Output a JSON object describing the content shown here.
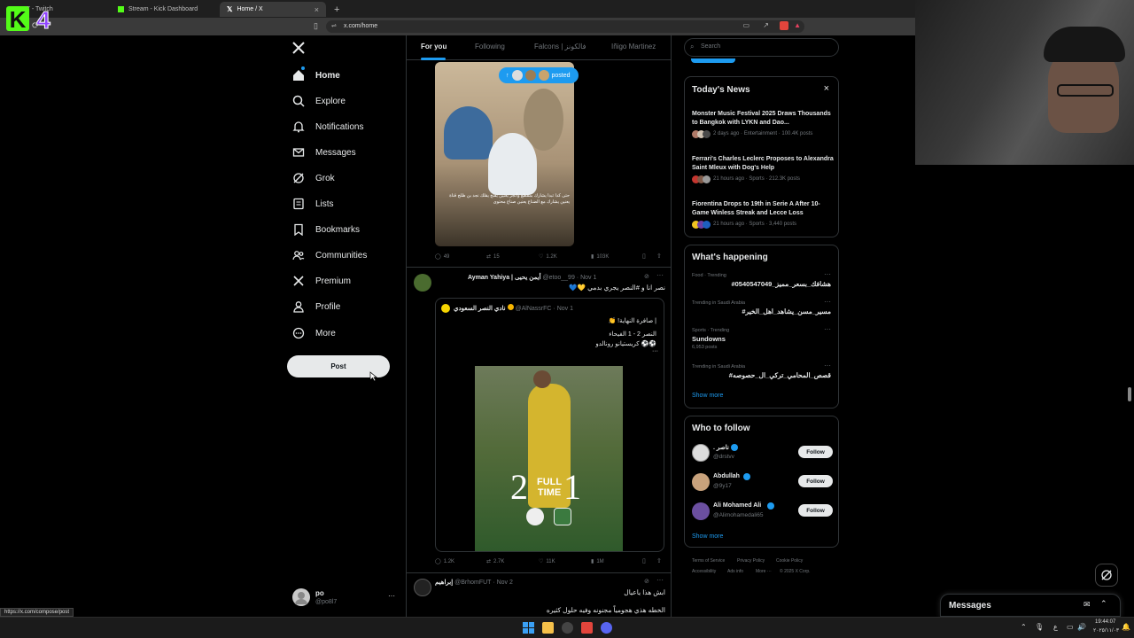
{
  "browser": {
    "tabs": [
      {
        "label": "7 - Twitch"
      },
      {
        "label": "Stream - Kick Dashboard"
      },
      {
        "label": "Home / X"
      }
    ],
    "url": "x.com/home",
    "status_url": "https://x.com/compose/post"
  },
  "overlay": {
    "kick_letter": "K",
    "kick_number": "4"
  },
  "nav": {
    "items": [
      {
        "label": "Home"
      },
      {
        "label": "Explore"
      },
      {
        "label": "Notifications"
      },
      {
        "label": "Messages"
      },
      {
        "label": "Grok"
      },
      {
        "label": "Lists"
      },
      {
        "label": "Bookmarks"
      },
      {
        "label": "Communities"
      },
      {
        "label": "Premium"
      },
      {
        "label": "Profile"
      },
      {
        "label": "More"
      }
    ],
    "post_label": "Post",
    "account": {
      "name": "po",
      "handle": "@po8l7"
    }
  },
  "feed": {
    "tabs": [
      "For you",
      "Following",
      "Falcons | فالكونز",
      "Iñigo Martinez"
    ],
    "new_posts_pill": "posted",
    "post1": {
      "caption_line1": "حتى كدا تبدا يشارك بمقطع وأنجز يعنين يفتح يقلك نجد بن ظلح قناة",
      "caption_line2": "يعنين يشارك مع الضناع يعنين صناع محتوى",
      "replies": "49",
      "reposts": "15",
      "likes": "1.2K",
      "views": "103K"
    },
    "post2": {
      "name": "Ayman Yahiya | أيمن يحيى",
      "handle": "@etoo__99",
      "date": "· Nov 1",
      "text": "نصر انا و #النصر يجري بدمي 💛💙",
      "quote": {
        "name": "نادي النصر السعودي",
        "handle": "@AlNassrFC",
        "date": "· Nov 1",
        "line1": "| صافرة النهاية! 👏",
        "line2": "النصر 2 - 1 الفيحاء",
        "line3": "⚽️⚽️ كريستيانو رونالدو",
        "graphic_left": "2",
        "graphic_mid1": "FULL",
        "graphic_mid2": "TIME",
        "graphic_right": "1"
      },
      "replies": "1.2K",
      "reposts": "2.7K",
      "likes": "11K",
      "views": "1M"
    },
    "post3": {
      "name": "إبراهيم",
      "handle": "@BrhomFUT",
      "date": "· Nov 2",
      "line1": "ابش هذا ياعيال",
      "line2": "الخطه هذي هجومياً مجنونه وفيه حلول كثيره"
    }
  },
  "sidebar": {
    "search_placeholder": "Search",
    "news": {
      "title": "Today's News",
      "items": [
        {
          "headline": "Monster Music Festival 2025 Draws Thousands to Bangkok with LYKN and Dao...",
          "meta": "2 days ago · Entertainment · 100.4K posts"
        },
        {
          "headline": "Ferrari's Charles Leclerc Proposes to Alexandra Saint Mleux with Dog's Help",
          "meta": "21 hours ago · Sports · 212.3K posts"
        },
        {
          "headline": "Fiorentina Drops to 19th in Serie A After 10-Game Winless Streak and Lecce Loss",
          "meta": "21 hours ago · Sports · 3,440 posts"
        }
      ]
    },
    "happening": {
      "title": "What's happening",
      "items": [
        {
          "context": "Food · Trending",
          "topic": "#هشافك_بسعر_مميز_0540547049",
          "posts": ""
        },
        {
          "context": "Trending in Saudi Arabia",
          "topic": "#مسير_مسن_يشاهد_اهل_الخير",
          "posts": ""
        },
        {
          "context": "Sports · Trending",
          "topic": "Sundowns",
          "posts": "6,953 posts"
        },
        {
          "context": "Trending in Saudi Arabia",
          "topic": "#قصص_المحامي_تركي_ال_حصوصه",
          "posts": ""
        }
      ],
      "show_more": "Show more"
    },
    "follow": {
      "title": "Who to follow",
      "items": [
        {
          "name": ". ناصر",
          "handle": "@drstvv",
          "button": "Follow"
        },
        {
          "name": "Abdullah",
          "handle": "@9y17",
          "button": "Follow"
        },
        {
          "name": "Ali Mohamed Ali",
          "handle": "@Alimohamedali65",
          "button": "Follow"
        }
      ],
      "show_more": "Show more"
    },
    "footer": {
      "links": [
        "Terms of Service",
        "Privacy Policy",
        "Cookie Policy",
        "Accessibility",
        "Ads info",
        "More ···",
        "© 2025 X Corp."
      ]
    }
  },
  "messages_dock": {
    "title": "Messages"
  },
  "taskbar": {
    "time": "19:44:07",
    "date": "٢٠٢٥/١١/٠٣",
    "lang": "ع"
  },
  "colors": {
    "accent": "#1d9bf0",
    "verified": "#1d9bf0",
    "border": "#2f3336",
    "muted": "#71767b",
    "kick_green": "#53fc18",
    "kick_purple": "#9146ff"
  }
}
